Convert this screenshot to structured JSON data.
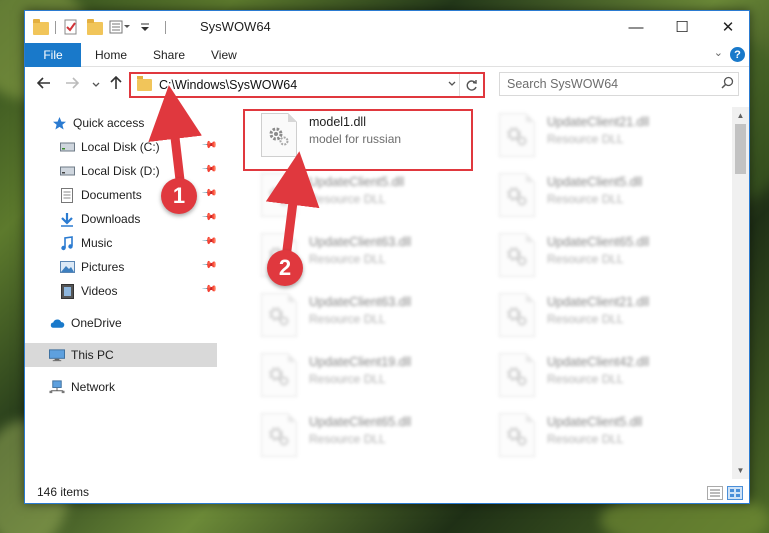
{
  "window": {
    "title": "SysWOW64",
    "controls": {
      "minimize": "—",
      "maximize": "☐",
      "close": "✕"
    }
  },
  "ribbon": {
    "file_tab": "File",
    "tabs": [
      "Home",
      "Share",
      "View"
    ],
    "help": "?"
  },
  "navigation": {
    "address": "C:\\Windows\\SysWOW64",
    "search_placeholder": "Search SysWOW64"
  },
  "sidebar": {
    "items": [
      {
        "label": "Quick access",
        "icon": "star-icon",
        "pinned": false
      },
      {
        "label": "Local Disk (C:)",
        "icon": "drive-icon",
        "pinned": true
      },
      {
        "label": "Local Disk (D:)",
        "icon": "drive-icon",
        "pinned": true
      },
      {
        "label": "Documents",
        "icon": "document-icon",
        "pinned": true
      },
      {
        "label": "Downloads",
        "icon": "download-icon",
        "pinned": true
      },
      {
        "label": "Music",
        "icon": "music-icon",
        "pinned": true
      },
      {
        "label": "Pictures",
        "icon": "picture-icon",
        "pinned": true
      },
      {
        "label": "Videos",
        "icon": "video-icon",
        "pinned": true
      },
      {
        "label": "OneDrive",
        "icon": "cloud-icon",
        "pinned": false
      },
      {
        "label": "This PC",
        "icon": "computer-icon",
        "pinned": false,
        "selected": true
      },
      {
        "label": "Network",
        "icon": "network-icon",
        "pinned": false
      }
    ]
  },
  "files": [
    {
      "name": "model1.dll",
      "desc": "model for russian",
      "highlighted": true
    },
    {
      "name": "UpdateClient21.dll",
      "desc": "Resource DLL"
    },
    {
      "name": "UpdateClient5.dll",
      "desc": "Resource DLL"
    },
    {
      "name": "UpdateClient5.dll",
      "desc": "Resource DLL"
    },
    {
      "name": "UpdateClient63.dll",
      "desc": "Resource DLL"
    },
    {
      "name": "UpdateClient65.dll",
      "desc": "Resource DLL"
    },
    {
      "name": "UpdateClient63.dll",
      "desc": "Resource DLL"
    },
    {
      "name": "UpdateClient21.dll",
      "desc": "Resource DLL"
    },
    {
      "name": "UpdateClient19.dll",
      "desc": "Resource DLL"
    },
    {
      "name": "UpdateClient42.dll",
      "desc": "Resource DLL"
    },
    {
      "name": "UpdateClient65.dll",
      "desc": "Resource DLL"
    },
    {
      "name": "UpdateClient5.dll",
      "desc": "Resource DLL"
    }
  ],
  "status": {
    "item_count": "146 items"
  },
  "annotations": {
    "step1": "1",
    "step2": "2"
  },
  "colors": {
    "accent": "#1979ca",
    "highlight": "#e0383e",
    "selected": "#d9d9d9"
  }
}
